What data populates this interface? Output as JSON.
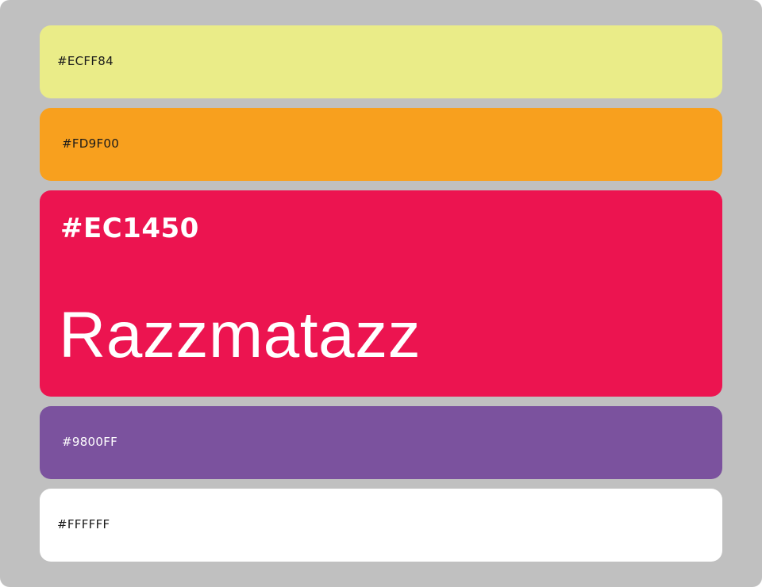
{
  "palette": {
    "swatches": [
      {
        "hex": "#ECFF84",
        "color": "#EAEC88",
        "text_color": "#1a1a1a"
      },
      {
        "hex": "#FD9F00",
        "color": "#F8A01E",
        "text_color": "#1a1a1a"
      },
      {
        "hex": "#EC1450",
        "color": "#EC1450",
        "text_color": "#ffffff",
        "name": "Razzmatazz",
        "selected": true
      },
      {
        "hex": "#9800FF",
        "color": "#7B529E",
        "text_color": "#ffffff"
      },
      {
        "hex": "#FFFFFF",
        "color": "#FFFFFF",
        "text_color": "#1a1a1a"
      }
    ]
  }
}
